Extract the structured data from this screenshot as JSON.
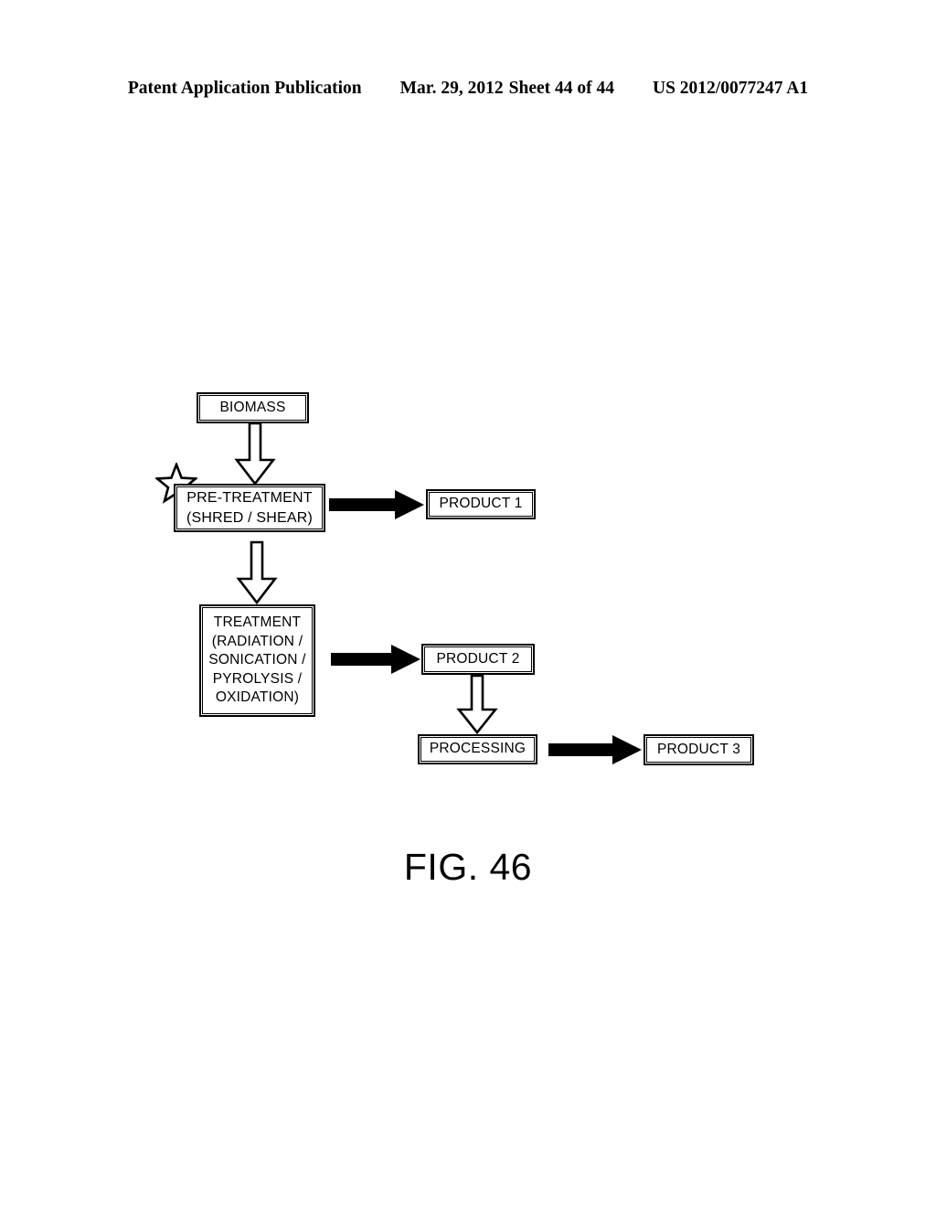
{
  "header": {
    "publication": "Patent Application Publication",
    "date": "Mar. 29, 2012",
    "sheet": "Sheet 44 of 44",
    "patent_number": "US 2012/0077247 A1"
  },
  "figure": {
    "caption": "FIG. 46",
    "colors": {
      "stroke": "#000000",
      "fill": "#ffffff",
      "solid_arrow": "#000000"
    },
    "nodes": [
      {
        "id": "biomass",
        "label": "BIOMASS"
      },
      {
        "id": "pretreatment",
        "label": "PRE-TREATMENT\n(SHRED / SHEAR)"
      },
      {
        "id": "product1",
        "label": "PRODUCT 1"
      },
      {
        "id": "treatment",
        "label": "TREATMENT\n(RADIATION /\nSONICATION /\nPYROLYSIS /\nOXIDATION)"
      },
      {
        "id": "product2",
        "label": "PRODUCT 2"
      },
      {
        "id": "processing",
        "label": "PROCESSING"
      },
      {
        "id": "product3",
        "label": "PRODUCT 3"
      }
    ],
    "edges": [
      {
        "from": "biomass",
        "to": "pretreatment",
        "style": "hollow-block-arrow",
        "direction": "down"
      },
      {
        "from": "pretreatment",
        "to": "product1",
        "style": "solid-arrow",
        "direction": "right"
      },
      {
        "from": "pretreatment",
        "to": "treatment",
        "style": "hollow-block-arrow",
        "direction": "down"
      },
      {
        "from": "treatment",
        "to": "product2",
        "style": "solid-arrow",
        "direction": "right"
      },
      {
        "from": "product2",
        "to": "processing",
        "style": "hollow-block-arrow",
        "direction": "down"
      },
      {
        "from": "processing",
        "to": "product3",
        "style": "solid-arrow",
        "direction": "right"
      }
    ],
    "annotations": [
      {
        "id": "star-marker",
        "shape": "five-pointed-star-outline",
        "attached_to": "pretreatment"
      }
    ]
  }
}
